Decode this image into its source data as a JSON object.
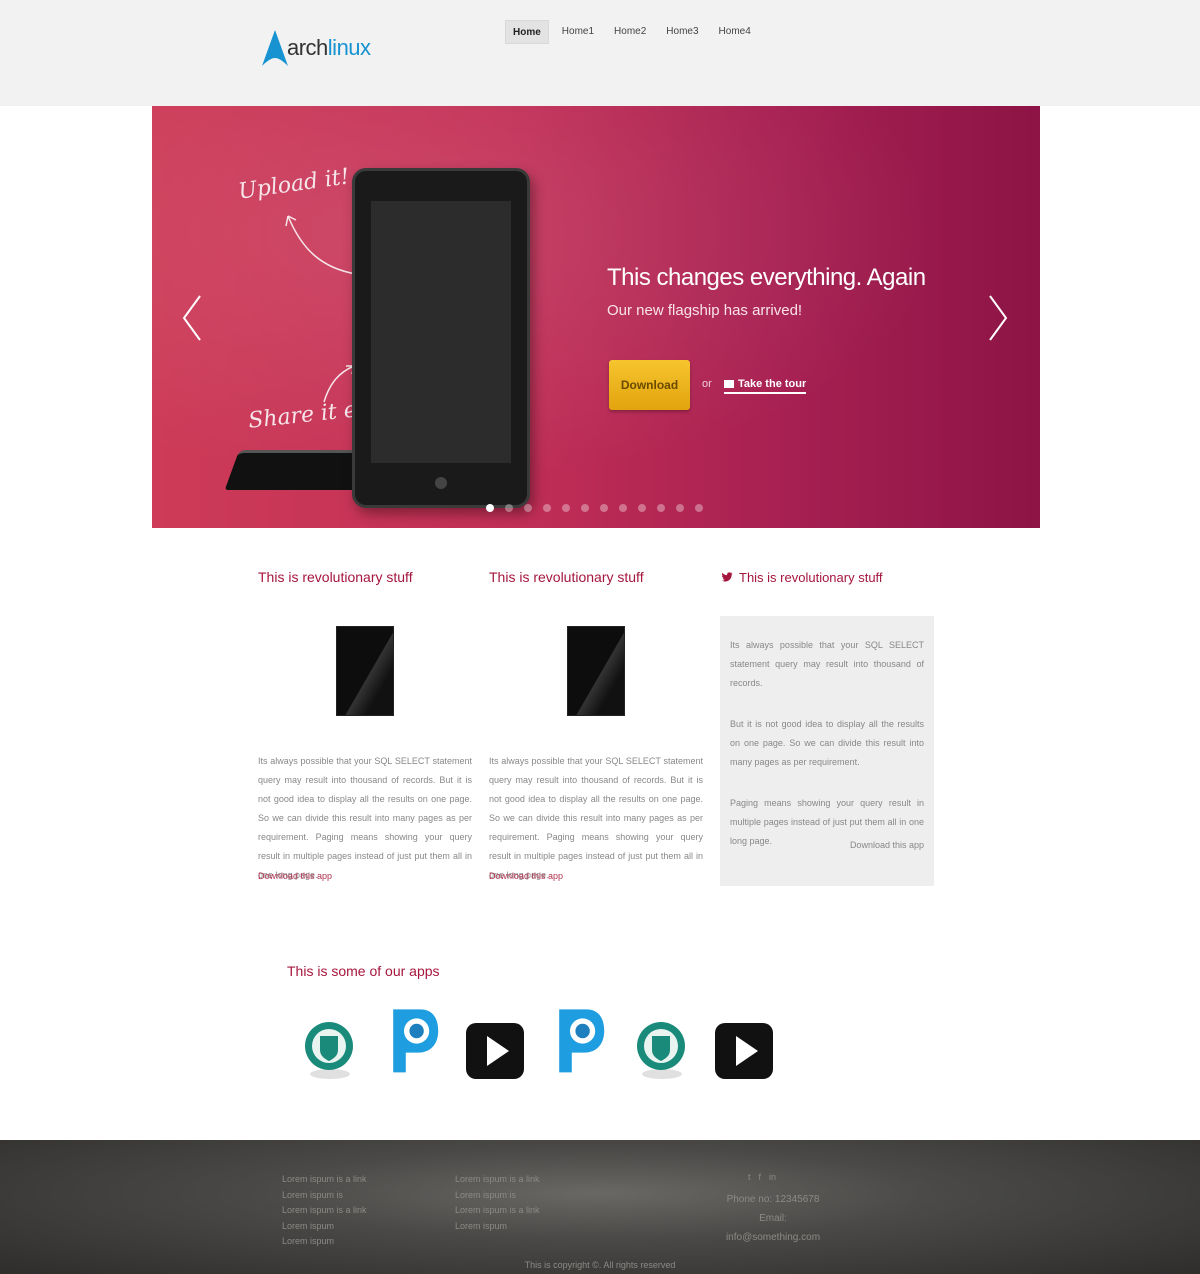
{
  "header": {
    "logo": {
      "arch": "arch",
      "linux": "linux"
    },
    "nav": [
      {
        "label": "Home",
        "active": true
      },
      {
        "label": "Home1",
        "active": false
      },
      {
        "label": "Home2",
        "active": false
      },
      {
        "label": "Home3",
        "active": false
      },
      {
        "label": "Home4",
        "active": false
      }
    ]
  },
  "hero": {
    "handwriting_1": "Upload it!",
    "handwriting_2": "Share it easily!",
    "title": "This changes everything. Again",
    "subtitle": "Our new flagship has arrived!",
    "download_label": "Download",
    "or_text": "or",
    "tour_label": "Take the tour",
    "slide_count": 12,
    "active_slide": 1,
    "colors": {
      "start": "#cd3b58",
      "end": "#8d1446",
      "button": "#f6c52e"
    }
  },
  "columns": [
    {
      "title": "This is revolutionary stuff",
      "text": "Its always possible that your SQL SELECT statement query may result into thousand of records. But it is not good idea to display all the results on one page. So we can divide this result into many pages as per requirement. Paging means showing your query result in multiple pages instead of just put them all in one long page.",
      "link": "Download this app"
    },
    {
      "title": "This is revolutionary stuff",
      "text": "Its always possible that your SQL SELECT statement query may result into thousand of records. But it is not good idea to display all the results on one page. So we can divide this result into many pages as per requirement. Paging means showing your query result in multiple pages instead of just put them all in one long page.",
      "link": "Download this app"
    }
  ],
  "sidebar": {
    "title": "This is revolutionary stuff",
    "paragraphs": [
      "Its always possible that your SQL SELECT statement query may result into thousand of records.",
      "But it is not good idea to display all the results on one page. So we can divide this result into many pages as per requirement.",
      "Paging means showing your query result in multiple pages instead of just put them all in one long page."
    ],
    "link": "Download this app"
  },
  "apps": {
    "title": "This is some of our apps",
    "icons": [
      "shield-app-icon",
      "p-app-icon",
      "play-app-icon",
      "p-app-icon",
      "shield-app-icon",
      "play-app-icon"
    ],
    "colors": {
      "teal": "#1a8a7a",
      "blue": "#1e9ee0",
      "black": "#111111"
    }
  },
  "footer": {
    "col1": [
      "Lorem ispum is a link",
      "Lorem ispum is",
      "Lorem ispum is a link",
      "Lorem ispum",
      "Lorem ispum"
    ],
    "col2": [
      "Lorem ispum is a link",
      "Lorem ispum is",
      "Lorem ispum is a link",
      "Lorem ispum"
    ],
    "social": [
      "t",
      "f",
      "in"
    ],
    "phone": "Phone no: 12345678",
    "email": "Email: info@something.com",
    "copyright": "This is copyright ©. All rights reserved"
  }
}
